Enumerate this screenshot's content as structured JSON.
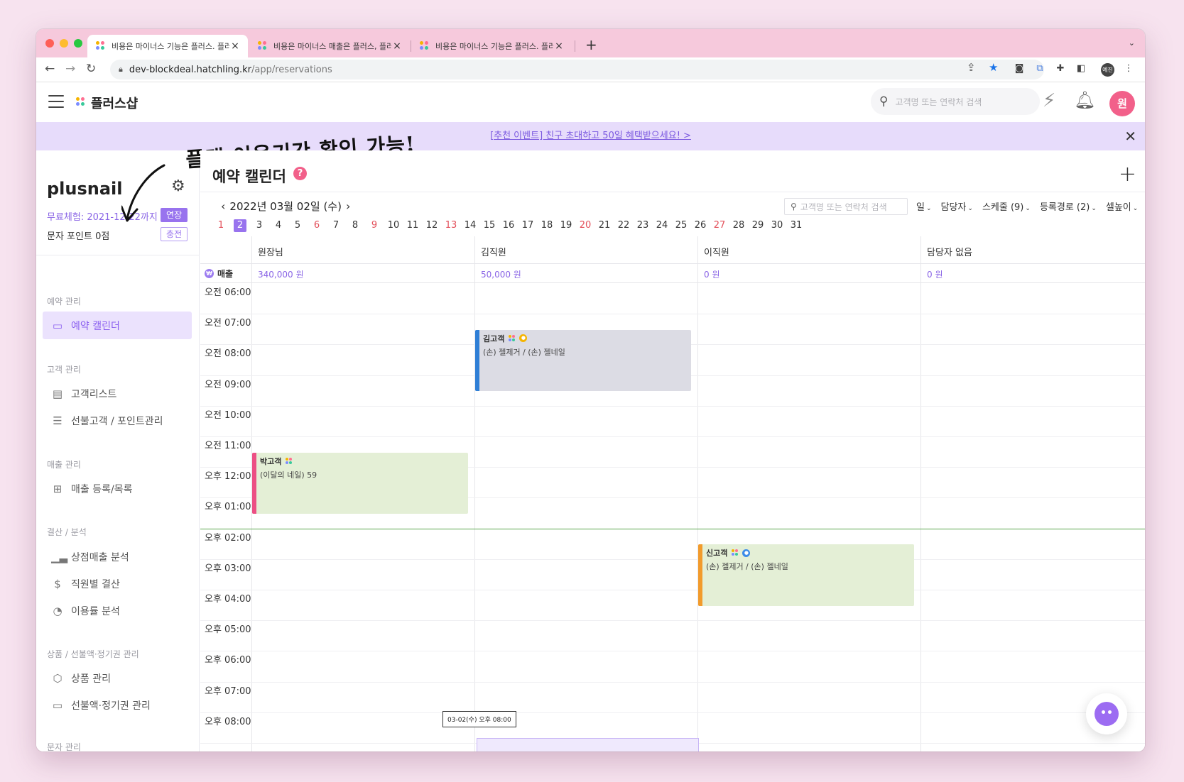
{
  "browser": {
    "tabs": [
      {
        "title": "비용은 마이너스 기능은 플러스. 플러"
      },
      {
        "title": "비용은 마이너스 매출은 플러스, 플러"
      },
      {
        "title": "비용은 마이너스 기능은 플러스. 플러"
      }
    ],
    "url_domain": "dev-blockdeal.hatchling.kr",
    "url_path": "/app/reservations",
    "profile_label": "예진"
  },
  "header": {
    "brand": "플러스샵",
    "search_placeholder": "고객명 또는 연락처 검색",
    "avatar": "원"
  },
  "banner": {
    "text": "[추천 이벤트] 친구 초대하고 50일 혜택받으세요! >"
  },
  "annotation": {
    "text": "플랜 이용기간 확인 가능!"
  },
  "sidebar": {
    "shop_name": "plusnail",
    "trial": "무료체험: 2021-12-22까지",
    "extend_label": "연장",
    "sms_points": "문자 포인트 0점",
    "charge_label": "충전",
    "sections": [
      {
        "title": "예약 관리",
        "items": [
          {
            "label": "예약 캘린더",
            "icon": "calendar-icon"
          }
        ]
      },
      {
        "title": "고객 관리",
        "items": [
          {
            "label": "고객리스트",
            "icon": "document-icon"
          },
          {
            "label": "선불고객 / 포인트관리",
            "icon": "database-icon"
          }
        ]
      },
      {
        "title": "매출 관리",
        "items": [
          {
            "label": "매출 등록/목록",
            "icon": "file-plus-icon"
          }
        ]
      },
      {
        "title": "결산 / 분석",
        "items": [
          {
            "label": "상점매출 분석",
            "icon": "bar-chart-icon"
          },
          {
            "label": "직원별 결산",
            "icon": "dollar-icon"
          },
          {
            "label": "이용률 분석",
            "icon": "pie-chart-icon"
          }
        ]
      },
      {
        "title": "상품 / 선불액·정기권 관리",
        "items": [
          {
            "label": "상품 관리",
            "icon": "box-icon"
          },
          {
            "label": "선불액·정기권 관리",
            "icon": "ticket-icon"
          }
        ]
      },
      {
        "title": "문자 관리",
        "items": []
      }
    ]
  },
  "calendar": {
    "title": "예약 캘린더",
    "help": "?",
    "date": "2022년 03월 02일 (수)",
    "search_placeholder": "고객명 또는 연락처 검색",
    "filters": [
      "일",
      "담당자",
      "스케줄 (9)",
      "등록경로 (2)",
      "셀높이"
    ],
    "days": [
      "1",
      "2",
      "3",
      "4",
      "5",
      "6",
      "7",
      "8",
      "9",
      "10",
      "11",
      "12",
      "13",
      "14",
      "15",
      "16",
      "17",
      "18",
      "19",
      "20",
      "21",
      "22",
      "23",
      "24",
      "25",
      "26",
      "27",
      "28",
      "29",
      "30",
      "31"
    ],
    "red_days": [
      "1",
      "6",
      "9",
      "13",
      "20",
      "27"
    ],
    "selected_day": "2",
    "sales_label": "매출",
    "staff": [
      {
        "name": "원장님",
        "sales": "340,000 원"
      },
      {
        "name": "김직원",
        "sales": "50,000 원"
      },
      {
        "name": "이직원",
        "sales": "0 원"
      },
      {
        "name": "담당자 없음",
        "sales": "0 원"
      }
    ],
    "times": [
      "오전 06:00",
      "오전 07:00",
      "오전 08:00",
      "오전 09:00",
      "오전 10:00",
      "오전 11:00",
      "오후 12:00",
      "오후 01:00",
      "오후 02:00",
      "오후 03:00",
      "오후 04:00",
      "오후 05:00",
      "오후 06:00",
      "오후 07:00",
      "오후 08:00"
    ],
    "appointments": [
      {
        "customer": "김고객",
        "service": "(손) 젤제거 / (손) 젤네일",
        "staff": "김직원",
        "start": "오전 07:30",
        "end": "오전 09:30",
        "bar_color": "#2f7fd6",
        "bg_color": "#dcdce4",
        "coin_color": "#f5b400"
      },
      {
        "customer": "박고객",
        "service": "(이달의 네일) 59",
        "staff": "원장님",
        "start": "오전 11:30",
        "end": "오후 01:30",
        "bar_color": "#ec4f84",
        "bg_color": "#e4efd6"
      },
      {
        "customer": "신고객",
        "service": "(손) 젤제거 / (손) 젤네일",
        "staff": "이직원",
        "start": "오후 02:30",
        "end": "오후 04:30",
        "bar_color": "#f29b2c",
        "bg_color": "#e4efd6",
        "coin_color": "#3b8be8"
      }
    ],
    "tooltip": "03-02(수) 오후 08:00"
  }
}
